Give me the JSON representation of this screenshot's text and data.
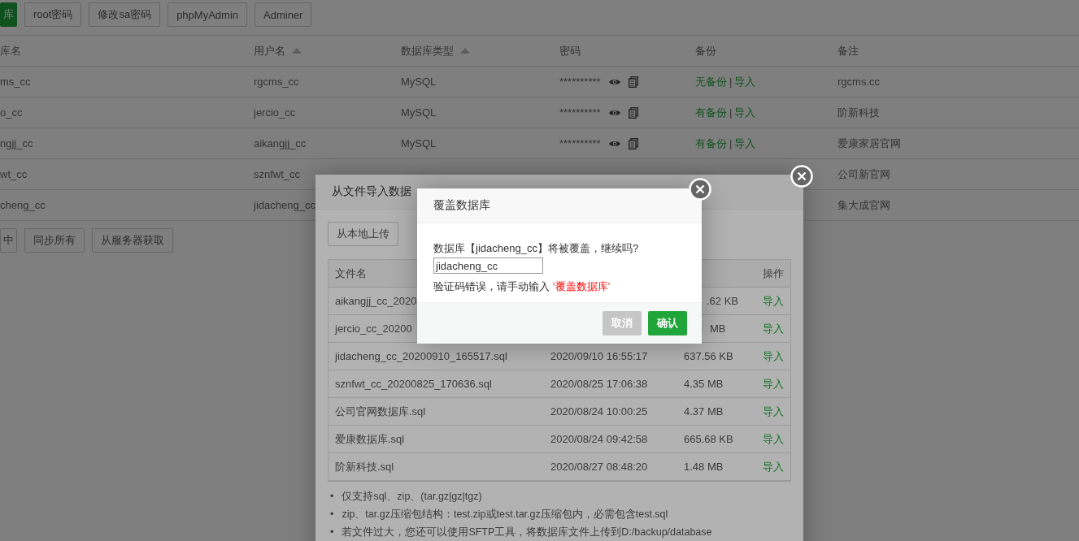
{
  "toolbar": [
    {
      "label": "库",
      "kind": "primary"
    },
    {
      "label": "root密码",
      "kind": "default"
    },
    {
      "label": "修改sa密码",
      "kind": "default"
    },
    {
      "label": "phpMyAdmin",
      "kind": "default"
    },
    {
      "label": "Adminer",
      "kind": "default"
    }
  ],
  "table": {
    "columns": [
      {
        "label": "库名",
        "sortable": false
      },
      {
        "label": "用户名",
        "sortable": true
      },
      {
        "label": "数据库类型",
        "sortable": true
      },
      {
        "label": "密码",
        "sortable": false
      },
      {
        "label": "备份",
        "sortable": false
      },
      {
        "label": "备注",
        "sortable": false
      }
    ],
    "rows": [
      {
        "name": "ms_cc",
        "user": "rgcms_cc",
        "type": "MySQL",
        "password": "**********",
        "backup": "无备份",
        "separator": "|",
        "import": "导入",
        "note": "rgcms.cc"
      },
      {
        "name": "o_cc",
        "user": "jercio_cc",
        "type": "MySQL",
        "password": "**********",
        "backup": "有备份",
        "separator": "|",
        "import": "导入",
        "note": "阶新科技"
      },
      {
        "name": "ngjj_cc",
        "user": "aikangjj_cc",
        "type": "MySQL",
        "password": "**********",
        "backup": "有备份",
        "separator": "|",
        "import": "导入",
        "note": "爱康家居官网"
      },
      {
        "name": "wt_cc",
        "user": "sznfwt_cc",
        "note": "公司新官网"
      },
      {
        "name": "cheng_cc",
        "user": "jidacheng_cc",
        "note": "集大成官网"
      }
    ]
  },
  "bottom_buttons": [
    "中",
    "同步所有",
    "从服务器获取"
  ],
  "import_dialog": {
    "title": "从文件导入数据",
    "upload_button": "从本地上传",
    "file_column": "文件名",
    "action_column": "操作",
    "files": [
      {
        "name": "aikangjj_cc_2020",
        "size": ".62 KB",
        "action": "导入"
      },
      {
        "name": "jercio_cc_20200",
        "size": "MB",
        "action": "导入"
      },
      {
        "name": "jidacheng_cc_20200910_165517.sql",
        "time": "2020/09/10 16:55:17",
        "size": "637.56 KB",
        "action": "导入"
      },
      {
        "name": "sznfwt_cc_20200825_170636.sql",
        "time": "2020/08/25 17:06:38",
        "size": "4.35 MB",
        "action": "导入"
      },
      {
        "name": "公司官网数据库.sql",
        "time": "2020/08/24 10:00:25",
        "size": "4.37 MB",
        "action": "导入"
      },
      {
        "name": "爱康数据库.sql",
        "time": "2020/08/24 09:42:58",
        "size": "665.68 KB",
        "action": "导入"
      },
      {
        "name": "阶新科技.sql",
        "time": "2020/08/27 08:48:20",
        "size": "1.48 MB",
        "action": "导入"
      }
    ],
    "notes": [
      {
        "bullet": "•",
        "text": "仅支持sql、zip、(tar.gz|gz|tgz)"
      },
      {
        "bullet": "•",
        "text": "zip、tar.gz压缩包结构：test.zip或test.tar.gz压缩包内，必需包含test.sql"
      },
      {
        "bullet": "•",
        "text": "若文件过大，您还可以使用SFTP工具，将数据库文件上传到D:/backup/database"
      }
    ]
  },
  "confirm_dialog": {
    "title": "覆盖数据库",
    "message": "数据库【jidacheng_cc】将被覆盖，继续吗?",
    "input_value": "jidacheng_cc",
    "error_text": "验证码错误，请手动输入",
    "error_code": "‘覆盖数据库’",
    "buttons": [
      {
        "label": "取消",
        "disabled": true
      },
      {
        "label": "确认",
        "disabled": false
      }
    ]
  }
}
